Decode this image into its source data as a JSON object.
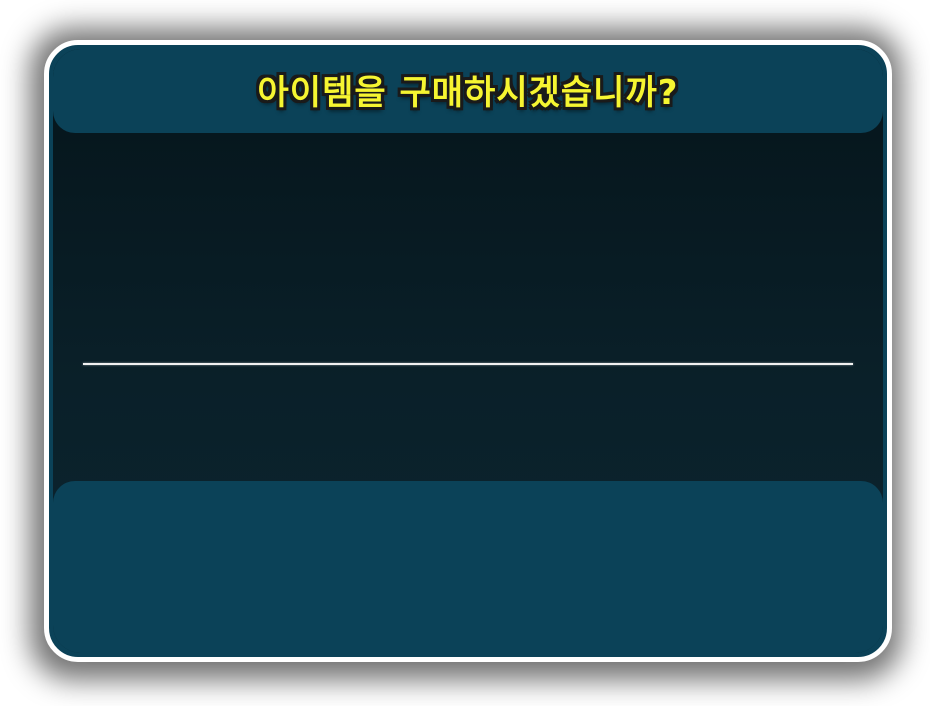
{
  "dialog": {
    "title": "아이템을 구매하시겠습니까?"
  },
  "colors": {
    "frame_border": "#ffffff",
    "panel_teal": "#0b4258",
    "content_dark": "#0a2029",
    "title_yellow": "#f6f531",
    "divider": "#f2f2f2"
  }
}
